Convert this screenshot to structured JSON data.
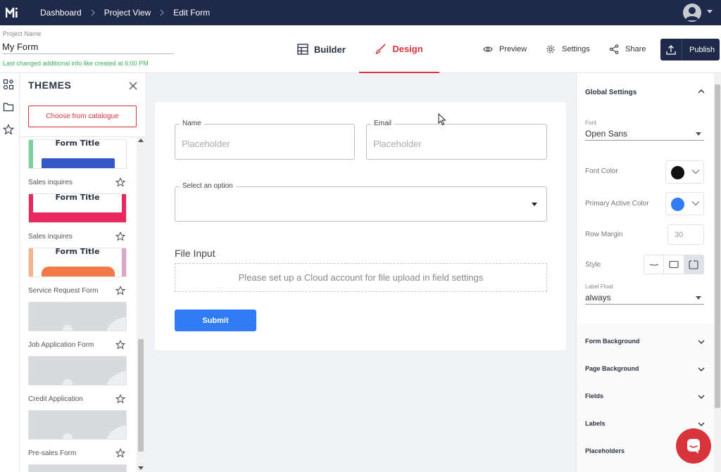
{
  "topbar": {
    "breadcrumbs": [
      "Dashboard",
      "Project View",
      "Edit Form"
    ]
  },
  "header": {
    "project_name_label": "Project Name",
    "project_name_value": "My Form",
    "last_changed_note": "Last changed additional info like created at 6:00 PM",
    "tabs": [
      {
        "label": "Builder",
        "icon": "builder-icon",
        "active": false
      },
      {
        "label": "Design",
        "icon": "brush-icon",
        "active": true
      }
    ],
    "actions": [
      {
        "label": "Preview",
        "icon": "eye-icon"
      },
      {
        "label": "Settings",
        "icon": "gear-icon"
      },
      {
        "label": "Share",
        "icon": "share-icon"
      }
    ],
    "publish_label": "Publish"
  },
  "themes": {
    "title": "THEMES",
    "catalogue_label": "Choose from catalogue",
    "items": [
      {
        "name": "Sales inquires",
        "preview_title": "Form Title",
        "accent": "#3558c7"
      },
      {
        "name": "Sales inquires",
        "preview_title": "Form Title",
        "accent": "#e8295e"
      },
      {
        "name": "Service Request Form",
        "preview_title": "Form Title",
        "accent": "#f47a4a"
      },
      {
        "name": "Job Application Form",
        "preview_title": "",
        "accent": ""
      },
      {
        "name": "Credit Application",
        "preview_title": "",
        "accent": ""
      },
      {
        "name": "Pre-sales Form",
        "preview_title": "",
        "accent": ""
      }
    ]
  },
  "form": {
    "fields": [
      {
        "label": "Name",
        "placeholder": "Placeholder"
      },
      {
        "label": "Email",
        "placeholder": "Placeholder"
      }
    ],
    "select_label": "Select an option",
    "file_input_title": "File Input",
    "file_input_note": "Please set up a Cloud account for file upload in field settings",
    "submit_label": "Submit"
  },
  "settings": {
    "global_title": "Global Settings",
    "font_label": "Font",
    "font_value": "Open Sans",
    "font_color_label": "Font Color",
    "font_color": "#111111",
    "primary_color_label": "Primary Active Color",
    "primary_color": "#2f7cf6",
    "row_margin_label": "Row Margin",
    "row_margin_value": "30",
    "style_label": "Style",
    "label_float_label": "Label Float",
    "label_float_value": "always",
    "sections": [
      "Form Background",
      "Page Background",
      "Fields",
      "Labels",
      "Placeholders"
    ]
  },
  "colors": {
    "navy": "#1f2a4a",
    "accent_red": "#d7343c",
    "primary_blue": "#2f7cf6",
    "success_green": "#3fb25a"
  }
}
